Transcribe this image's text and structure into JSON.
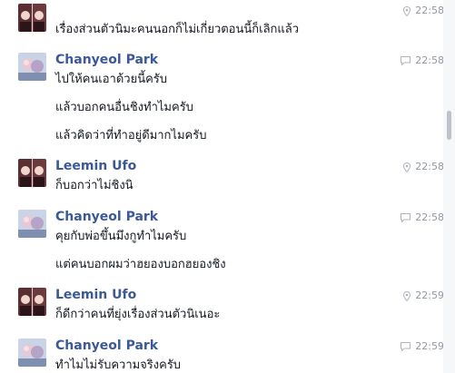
{
  "messages": [
    {
      "sender": "",
      "avatar": "leemin-avatar",
      "time": "22:58",
      "status_icon": "location-pin-icon",
      "lines": [
        "เรื่องส่วนตัวนิมะคนนอกก็ไม่เกี่ยวตอนนี้ก็เลิกแล้ว"
      ]
    },
    {
      "sender": "Chanyeol Park",
      "avatar": "chanyeol-avatar",
      "time": "22:58",
      "status_icon": "chat-bubble-icon",
      "lines": [
        "ไปให้คนเอาด้วยนี้ครับ",
        "แล้วบอกคนอื่นชิงทำไมครับ",
        "แล้วคิดว่าที่ทำอยู่ดีมากไมครับ"
      ]
    },
    {
      "sender": "Leemin Ufo",
      "avatar": "leemin-avatar",
      "time": "22:58",
      "status_icon": "location-pin-icon",
      "lines": [
        "ก็บอกว่าไม่ชิงนิ"
      ]
    },
    {
      "sender": "Chanyeol Park",
      "avatar": "chanyeol-avatar",
      "time": "22:58",
      "status_icon": "chat-bubble-icon",
      "lines": [
        "คุยกับพ่อขึ้นมึงกูทำไมครับ",
        "แต่คนบอกผมว่าฮยองบอกฮยองชิง"
      ]
    },
    {
      "sender": "Leemin Ufo",
      "avatar": "leemin-avatar",
      "time": "22:59",
      "status_icon": "location-pin-icon",
      "lines": [
        "ก็ดีกว่าคนที่ยุ่งเรื่องส่วนตัวนิเนอะ"
      ]
    },
    {
      "sender": "Chanyeol Park",
      "avatar": "chanyeol-avatar",
      "time": "22:59",
      "status_icon": "chat-bubble-icon",
      "lines": [
        "ทำไมไม่รับความจริงครับ"
      ]
    }
  ],
  "colors": {
    "sender_name": "#3b5998",
    "message_text": "#141823",
    "timestamp": "#9197a3",
    "background": "#ffffff"
  }
}
